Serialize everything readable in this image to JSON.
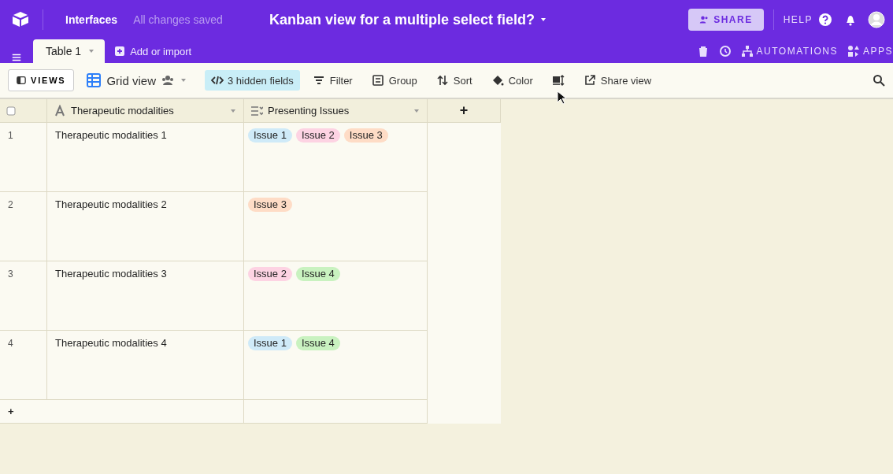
{
  "topbar": {
    "nav_link": "Interfaces",
    "save_status": "All changes saved",
    "base_title": "Kanban view for a multiple select field?",
    "share_button": "SHARE",
    "help": "HELP"
  },
  "table_tabs": [
    {
      "label": "Table 1",
      "selected": true
    }
  ],
  "add_table": "Add or import",
  "tab_actions": {
    "automations": "AUTOMATIONS",
    "apps": "APPS"
  },
  "toolbar": {
    "views_button": "VIEWS",
    "view_name": "Grid view",
    "hidden_fields": "3 hidden fields",
    "items": [
      {
        "kind": "filter",
        "label": "Filter"
      },
      {
        "kind": "group",
        "label": "Group"
      },
      {
        "kind": "sort",
        "label": "Sort"
      },
      {
        "kind": "color",
        "label": "Color"
      },
      {
        "kind": "row-height"
      },
      {
        "kind": "share",
        "label": "Share view"
      }
    ]
  },
  "table": {
    "select_all_checked": false,
    "columns": [
      {
        "kind": "text",
        "label": "Therapeutic modalities"
      },
      {
        "kind": "multiselect",
        "label": "Presenting Issues"
      }
    ],
    "add_column": "+",
    "rows": [
      {
        "number": "1",
        "name": "Therapeutic modalities 1",
        "tags": [
          {
            "label": "Issue 1",
            "color": "#cfeaf8"
          },
          {
            "label": "Issue 2",
            "color": "#fdd3e3"
          },
          {
            "label": "Issue 3",
            "color": "#fedcc6"
          }
        ]
      },
      {
        "number": "2",
        "name": "Therapeutic modalities 2",
        "tags": [
          {
            "label": "Issue 3",
            "color": "#fedcc6"
          }
        ]
      },
      {
        "number": "3",
        "name": "Therapeutic modalities 3",
        "tags": [
          {
            "label": "Issue 2",
            "color": "#fdd3e3"
          },
          {
            "label": "Issue 4",
            "color": "#c9f2c0"
          }
        ]
      },
      {
        "number": "4",
        "name": "Therapeutic modalities 4",
        "tags": [
          {
            "label": "Issue 1",
            "color": "#cfeaf8"
          },
          {
            "label": "Issue 4",
            "color": "#c9f2c0"
          }
        ]
      }
    ],
    "add_row": "+"
  }
}
